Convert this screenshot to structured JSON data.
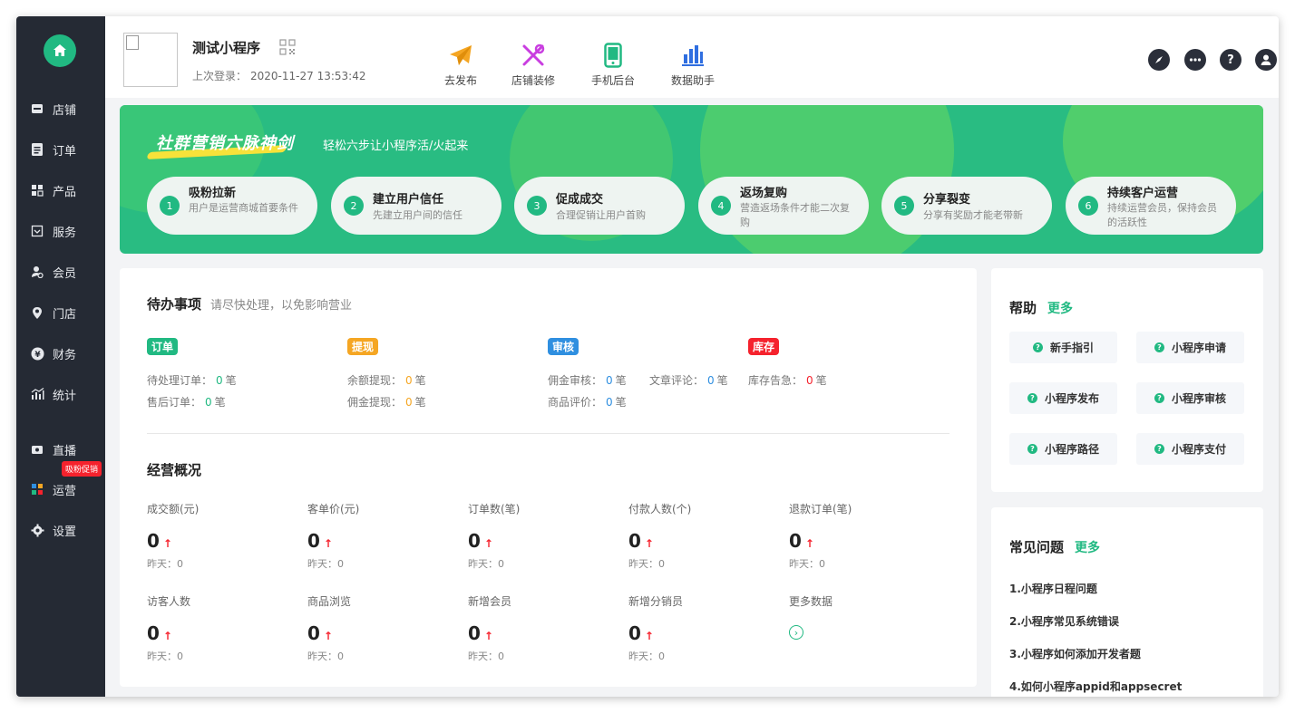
{
  "sidebar": {
    "logo_icon": "home-icon",
    "items": [
      {
        "label": "店铺",
        "icon": "store-icon"
      },
      {
        "label": "订单",
        "icon": "order-icon"
      },
      {
        "label": "产品",
        "icon": "product-icon"
      },
      {
        "label": "服务",
        "icon": "service-icon"
      },
      {
        "label": "会员",
        "icon": "member-icon"
      },
      {
        "label": "门店",
        "icon": "location-icon"
      },
      {
        "label": "财务",
        "icon": "yen-icon"
      },
      {
        "label": "统计",
        "icon": "stats-icon"
      },
      {
        "label": "直播",
        "icon": "live-icon"
      },
      {
        "label": "运营",
        "icon": "operations-icon"
      },
      {
        "label": "设置",
        "icon": "settings-icon"
      }
    ],
    "promo_badge": "吸粉促销"
  },
  "header": {
    "app_name": "测试小程序",
    "last_login_label": "上次登录：",
    "last_login_time": "2020-11-27 13:53:42",
    "tools": [
      {
        "label": "去发布",
        "icon": "paper-plane-icon",
        "color": "#f5a623"
      },
      {
        "label": "店铺装修",
        "icon": "tools-icon",
        "color": "#c93ee0"
      },
      {
        "label": "手机后台",
        "icon": "phone-icon",
        "color": "#21b982"
      },
      {
        "label": "数据助手",
        "icon": "bar-chart-icon",
        "color": "#2f6ee0"
      }
    ],
    "right_icons": [
      "compass-icon",
      "chat-icon",
      "help-icon",
      "user-icon"
    ]
  },
  "banner": {
    "title": "社群营销六脉神剑",
    "subtitle": "轻松六步让小程序活/火起来",
    "steps": [
      {
        "num": "1",
        "title": "吸粉拉新",
        "desc": "用户是运营商城首要条件"
      },
      {
        "num": "2",
        "title": "建立用户信任",
        "desc": "先建立用户间的信任"
      },
      {
        "num": "3",
        "title": "促成成交",
        "desc": "合理促销让用户首购"
      },
      {
        "num": "4",
        "title": "返场复购",
        "desc": "营造返场条件才能二次复购"
      },
      {
        "num": "5",
        "title": "分享裂变",
        "desc": "分享有奖励才能老带新"
      },
      {
        "num": "6",
        "title": "持续客户运营",
        "desc": "持续运营会员，保持会员的活跃性"
      }
    ]
  },
  "todo": {
    "title": "待办事项",
    "subtitle": "请尽快处理，以免影响营业",
    "tags": [
      {
        "label": "订单",
        "color": "#21b982"
      },
      {
        "label": "提现",
        "color": "#f5a623"
      },
      {
        "label": "审核",
        "color": "#2f8fe0"
      },
      {
        "label": "库存",
        "color": "#f5222d"
      }
    ],
    "items": {
      "pending_orders": {
        "label": "待处理订单：",
        "value": "0",
        "unit": "笔"
      },
      "after_sale": {
        "label": "售后订单：",
        "value": "0",
        "unit": "笔"
      },
      "balance_withdraw": {
        "label": "余额提现：",
        "value": "0",
        "unit": "笔"
      },
      "commission_withdraw": {
        "label": "佣金提现：",
        "value": "0",
        "unit": "笔"
      },
      "commission_review": {
        "label": "佣金审核：",
        "value": "0",
        "unit": "笔"
      },
      "article_comment": {
        "label": "文章评论：",
        "value": "0",
        "unit": "笔"
      },
      "product_review": {
        "label": "商品评价：",
        "value": "0",
        "unit": "笔"
      },
      "stock_alert": {
        "label": "库存告急：",
        "value": "0",
        "unit": "笔"
      }
    }
  },
  "overview": {
    "title": "经营概况",
    "metrics": [
      {
        "label": "成交额(元)",
        "value": "0",
        "yesterday": "昨天：0"
      },
      {
        "label": "客单价(元)",
        "value": "0",
        "yesterday": "昨天：0"
      },
      {
        "label": "订单数(笔)",
        "value": "0",
        "yesterday": "昨天：0"
      },
      {
        "label": "付款人数(个)",
        "value": "0",
        "yesterday": "昨天：0"
      },
      {
        "label": "退款订单(笔)",
        "value": "0",
        "yesterday": "昨天：0"
      },
      {
        "label": "访客人数",
        "value": "0",
        "yesterday": "昨天：0"
      },
      {
        "label": "商品浏览",
        "value": "0",
        "yesterday": "昨天：0"
      },
      {
        "label": "新增会员",
        "value": "0",
        "yesterday": "昨天：0"
      },
      {
        "label": "新增分销员",
        "value": "0",
        "yesterday": "昨天：0"
      }
    ],
    "more_label": "更多数据",
    "up_arrow": "↑"
  },
  "help": {
    "title": "帮助",
    "more": "更多",
    "buttons": [
      "新手指引",
      "小程序申请",
      "小程序发布",
      "小程序审核",
      "小程序路径",
      "小程序支付"
    ]
  },
  "faq": {
    "title": "常见问题",
    "more": "更多",
    "items": [
      "1.小程序日程问题",
      "2.小程序常见系统错误",
      "3.小程序如何添加开发者题",
      "4.如何小程序appid和appsecret"
    ]
  }
}
